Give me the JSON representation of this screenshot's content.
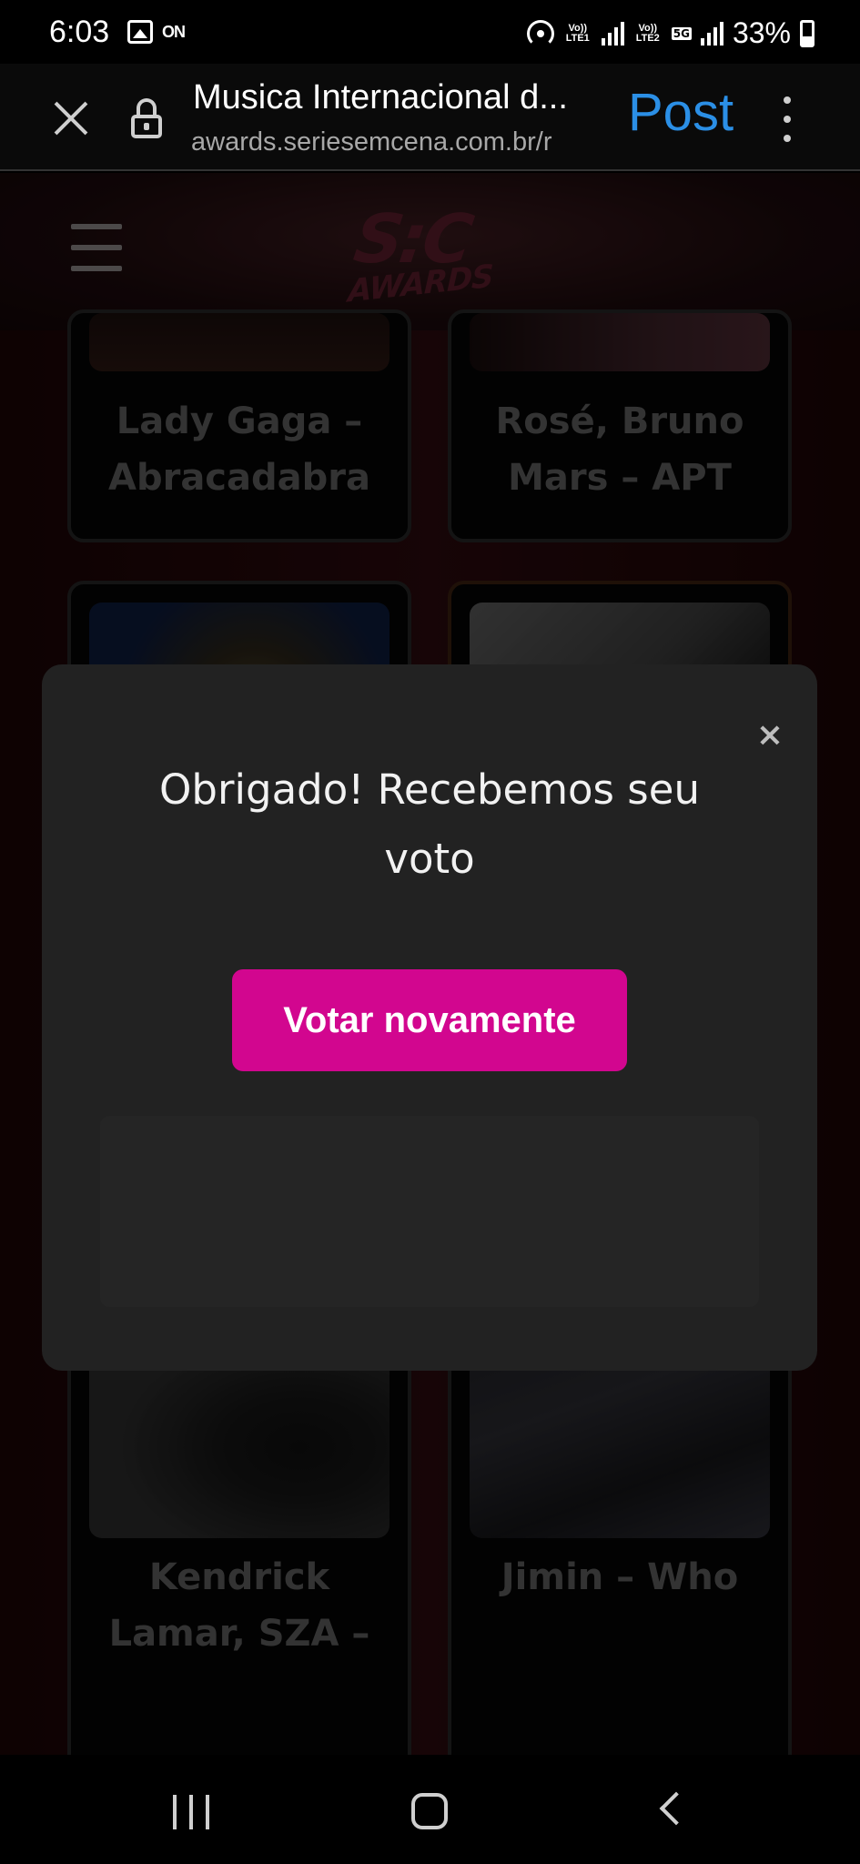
{
  "status_bar": {
    "time": "6:03",
    "on_label": "ON",
    "sim1_label": "Vo)) LTE1",
    "sim2_label": "Vo)) LTE2",
    "network_label": "5G",
    "battery_percent": "33%"
  },
  "browser": {
    "title": "Musica Internacional d...",
    "url": "awards.seriesemcena.com.br/r",
    "post_label": "Post",
    "icons": [
      "close-icon",
      "lock-icon",
      "more-vertical-icon"
    ]
  },
  "site": {
    "logo_top": "S:C",
    "logo_bottom": "AWARDS",
    "cards": [
      {
        "label_line1": "Lady Gaga –",
        "label_line2": "Abracadabra"
      },
      {
        "label_line1": "Rosé, Bruno",
        "label_line2": "Mars – APT"
      },
      {
        "label_line1": "Kendrick",
        "label_line2": "Lamar, SZA –"
      },
      {
        "label_line1": "Jimin – Who",
        "label_line2": ""
      }
    ]
  },
  "modal": {
    "close_symbol": "×",
    "message": "Obrigado! Recebemos seu voto",
    "button_label": "Votar novamente",
    "accent_color": "#d2068f"
  },
  "nav_bar": {
    "icons": [
      "recent-apps-icon",
      "home-icon",
      "back-icon"
    ]
  }
}
